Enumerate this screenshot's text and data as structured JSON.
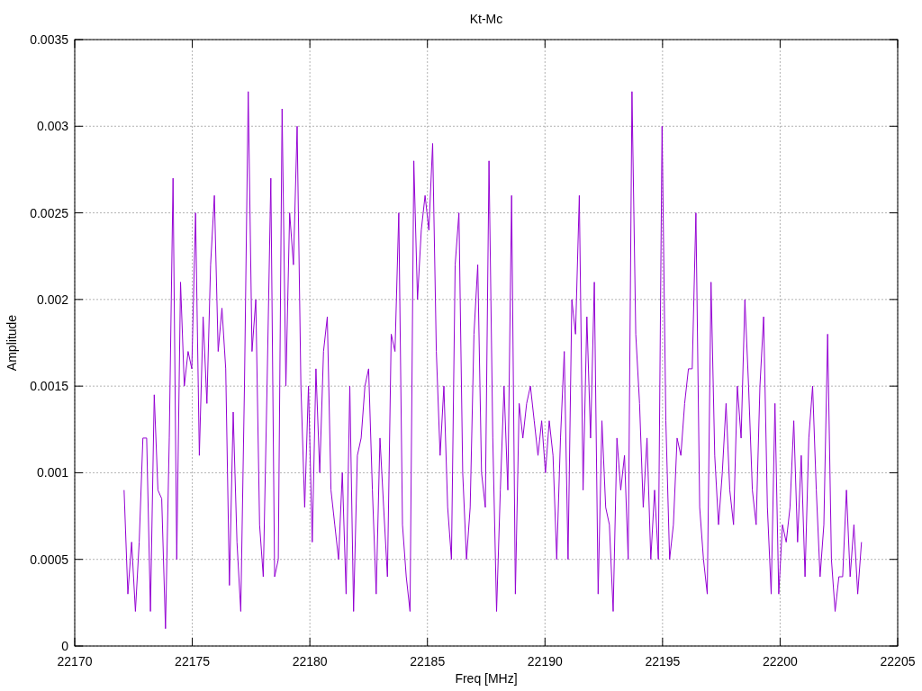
{
  "chart": {
    "chart_data": {
      "type": "line",
      "title": "Kt-Mc",
      "xlabel": "Freq [MHz]",
      "ylabel": "Amplitude",
      "grid": true,
      "xlim": [
        22170,
        22205
      ],
      "ylim": [
        0,
        0.0035
      ],
      "xticks": [
        22170,
        22175,
        22180,
        22185,
        22190,
        22195,
        22200,
        22205
      ],
      "yticks": [
        0,
        0.0005,
        0.001,
        0.0015,
        0.002,
        0.0025,
        0.003,
        0.0035
      ],
      "x": [
        22172.1,
        22172.26,
        22172.42,
        22172.58,
        22172.74,
        22172.9,
        22173.06,
        22173.22,
        22173.38,
        22173.54,
        22173.7,
        22173.86,
        22174.02,
        22174.18,
        22174.34,
        22174.5,
        22174.66,
        22174.82,
        22174.98,
        22175.14,
        22175.3,
        22175.46,
        22175.62,
        22175.78,
        22175.94,
        22176.1,
        22176.26,
        22176.42,
        22176.58,
        22176.74,
        22176.9,
        22177.06,
        22177.22,
        22177.38,
        22177.54,
        22177.7,
        22177.86,
        22178.02,
        22178.18,
        22178.34,
        22178.5,
        22178.66,
        22178.82,
        22178.98,
        22179.14,
        22179.3,
        22179.46,
        22179.62,
        22179.78,
        22179.94,
        22180.1,
        22180.26,
        22180.42,
        22180.58,
        22180.74,
        22180.9,
        22181.06,
        22181.22,
        22181.38,
        22181.54,
        22181.7,
        22181.86,
        22182.02,
        22182.18,
        22182.34,
        22182.5,
        22182.66,
        22182.82,
        22182.98,
        22183.14,
        22183.3,
        22183.46,
        22183.62,
        22183.78,
        22183.94,
        22184.1,
        22184.26,
        22184.42,
        22184.58,
        22184.74,
        22184.9,
        22185.06,
        22185.22,
        22185.38,
        22185.54,
        22185.7,
        22185.86,
        22186.02,
        22186.18,
        22186.34,
        22186.5,
        22186.66,
        22186.82,
        22186.98,
        22187.14,
        22187.3,
        22187.46,
        22187.62,
        22187.78,
        22187.94,
        22188.1,
        22188.26,
        22188.42,
        22188.58,
        22188.74,
        22188.9,
        22189.06,
        22189.22,
        22189.38,
        22189.54,
        22189.7,
        22189.86,
        22190.02,
        22190.18,
        22190.34,
        22190.5,
        22190.66,
        22190.82,
        22190.98,
        22191.14,
        22191.3,
        22191.46,
        22191.62,
        22191.78,
        22191.94,
        22192.1,
        22192.26,
        22192.42,
        22192.58,
        22192.74,
        22192.9,
        22193.06,
        22193.22,
        22193.38,
        22193.54,
        22193.7,
        22193.86,
        22194.02,
        22194.18,
        22194.34,
        22194.5,
        22194.66,
        22194.82,
        22194.98,
        22195.14,
        22195.3,
        22195.46,
        22195.62,
        22195.78,
        22195.94,
        22196.1,
        22196.26,
        22196.42,
        22196.58,
        22196.74,
        22196.9,
        22197.06,
        22197.22,
        22197.38,
        22197.54,
        22197.7,
        22197.86,
        22198.02,
        22198.18,
        22198.34,
        22198.5,
        22198.66,
        22198.82,
        22198.98,
        22199.14,
        22199.3,
        22199.46,
        22199.62,
        22199.78,
        22199.94,
        22200.1,
        22200.26,
        22200.42,
        22200.58,
        22200.74,
        22200.9,
        22201.06,
        22201.22,
        22201.38,
        22201.54,
        22201.7,
        22201.86,
        22202.02,
        22202.18,
        22202.34,
        22202.5,
        22202.66,
        22202.82,
        22202.98,
        22203.14,
        22203.3,
        22203.46
      ],
      "series": [
        {
          "color": "#9400d3",
          "values": [
            0.0009,
            0.0003,
            0.0006,
            0.0002,
            0.0006,
            0.0012,
            0.0012,
            0.0002,
            0.00145,
            0.0009,
            0.00085,
            0.0001,
            0.0012,
            0.0027,
            0.0005,
            0.0021,
            0.0015,
            0.0017,
            0.0016,
            0.0025,
            0.0011,
            0.0019,
            0.0014,
            0.0022,
            0.0026,
            0.0017,
            0.00195,
            0.0016,
            0.00035,
            0.00135,
            0.0006,
            0.0002,
            0.0015,
            0.0032,
            0.0017,
            0.002,
            0.0007,
            0.0004,
            0.0015,
            0.0027,
            0.0004,
            0.0005,
            0.0031,
            0.0015,
            0.0025,
            0.0022,
            0.003,
            0.0015,
            0.0008,
            0.0015,
            0.0006,
            0.0016,
            0.001,
            0.0017,
            0.0019,
            0.0009,
            0.0007,
            0.0005,
            0.001,
            0.0003,
            0.0015,
            0.0002,
            0.0011,
            0.0012,
            0.0015,
            0.0016,
            0.0009,
            0.0003,
            0.0012,
            0.0008,
            0.0004,
            0.0018,
            0.0017,
            0.0025,
            0.0007,
            0.0004,
            0.0002,
            0.0028,
            0.002,
            0.0024,
            0.0026,
            0.0024,
            0.0029,
            0.0017,
            0.0011,
            0.0015,
            0.0008,
            0.0005,
            0.0022,
            0.0025,
            0.001,
            0.0005,
            0.0008,
            0.0018,
            0.0022,
            0.001,
            0.0008,
            0.0028,
            0.0012,
            0.0002,
            0.0009,
            0.0015,
            0.0009,
            0.0026,
            0.0003,
            0.0014,
            0.0012,
            0.0014,
            0.0015,
            0.0013,
            0.0011,
            0.0013,
            0.001,
            0.0013,
            0.0011,
            0.0005,
            0.0012,
            0.0017,
            0.0005,
            0.002,
            0.0018,
            0.0026,
            0.0009,
            0.0019,
            0.0012,
            0.0021,
            0.0003,
            0.0013,
            0.0008,
            0.0007,
            0.0002,
            0.0012,
            0.0009,
            0.0011,
            0.0005,
            0.0032,
            0.0018,
            0.0014,
            0.0008,
            0.0012,
            0.0005,
            0.0009,
            0.0005,
            0.003,
            0.0013,
            0.0005,
            0.0007,
            0.0012,
            0.0011,
            0.0014,
            0.0016,
            0.0016,
            0.0025,
            0.0008,
            0.0005,
            0.0003,
            0.0021,
            0.0011,
            0.0007,
            0.001,
            0.0014,
            0.0009,
            0.0007,
            0.0015,
            0.0012,
            0.002,
            0.0015,
            0.0009,
            0.0007,
            0.0015,
            0.0019,
            0.0008,
            0.0003,
            0.0014,
            0.0003,
            0.0007,
            0.0006,
            0.0008,
            0.0013,
            0.0006,
            0.0011,
            0.0004,
            0.0012,
            0.0015,
            0.0009,
            0.0004,
            0.0007,
            0.0018,
            0.0005,
            0.0002,
            0.0004,
            0.0004,
            0.0009,
            0.0004,
            0.0007,
            0.0003,
            0.0006
          ]
        }
      ]
    }
  }
}
